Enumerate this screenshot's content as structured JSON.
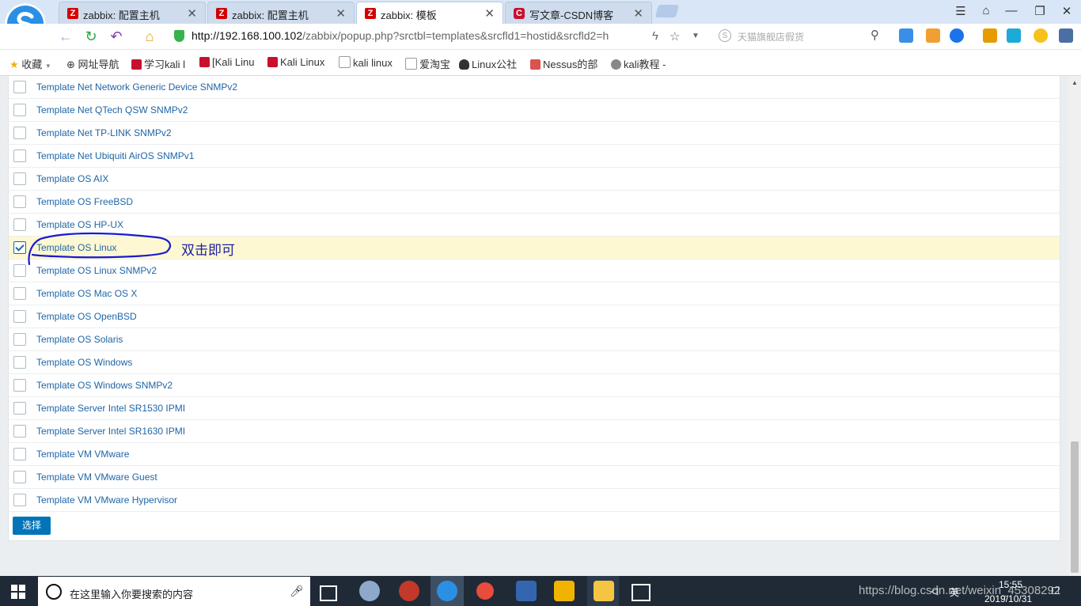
{
  "tabs": [
    {
      "label": "zabbix: 配置主机",
      "favicon": "Z",
      "active": false
    },
    {
      "label": "zabbix: 配置主机",
      "favicon": "Z",
      "active": false
    },
    {
      "label": "zabbix: 模板",
      "favicon": "Z",
      "active": true
    },
    {
      "label": "写文章-CSDN博客",
      "favicon": "C",
      "active": false
    }
  ],
  "address": {
    "host": "http://192.168.100.102",
    "path": "/zabbix/popup.php?srctbl=templates&srcfld1=hostid&srcfld2=h"
  },
  "search": {
    "placeholder": "天猫旗舰店假货"
  },
  "bookmarks": [
    "收藏",
    "网址导航",
    "学习kali l",
    "[Kali Linu",
    "Kali Linux",
    "kali linux",
    "爱淘宝",
    "Linux公社",
    "Nessus的部",
    "kali教程 -"
  ],
  "templates": [
    {
      "name": "Template Net Network Generic Device SNMPv2",
      "checked": false
    },
    {
      "name": "Template Net QTech QSW SNMPv2",
      "checked": false
    },
    {
      "name": "Template Net TP-LINK SNMPv2",
      "checked": false
    },
    {
      "name": "Template Net Ubiquiti AirOS SNMPv1",
      "checked": false
    },
    {
      "name": "Template OS AIX",
      "checked": false
    },
    {
      "name": "Template OS FreeBSD",
      "checked": false
    },
    {
      "name": "Template OS HP-UX",
      "checked": false
    },
    {
      "name": "Template OS Linux",
      "checked": true
    },
    {
      "name": "Template OS Linux SNMPv2",
      "checked": false
    },
    {
      "name": "Template OS Mac OS X",
      "checked": false
    },
    {
      "name": "Template OS OpenBSD",
      "checked": false
    },
    {
      "name": "Template OS Solaris",
      "checked": false
    },
    {
      "name": "Template OS Windows",
      "checked": false
    },
    {
      "name": "Template OS Windows SNMPv2",
      "checked": false
    },
    {
      "name": "Template Server Intel SR1530 IPMI",
      "checked": false
    },
    {
      "name": "Template Server Intel SR1630 IPMI",
      "checked": false
    },
    {
      "name": "Template VM VMware",
      "checked": false
    },
    {
      "name": "Template VM VMware Guest",
      "checked": false
    },
    {
      "name": "Template VM VMware Hypervisor",
      "checked": false
    }
  ],
  "annotation": "双击即可",
  "select_button": "选择",
  "taskbar": {
    "search_placeholder": "在这里输入你要搜索的内容",
    "ime": "英",
    "time": "15:55",
    "date": "2019/10/31",
    "watermark": "https://blog.csdn.net/weixin_45308292"
  },
  "colors": {
    "link": "#1f65a6",
    "selected_row": "#fef8d2",
    "button": "#0275b8",
    "taskbar": "#1f2a36"
  }
}
